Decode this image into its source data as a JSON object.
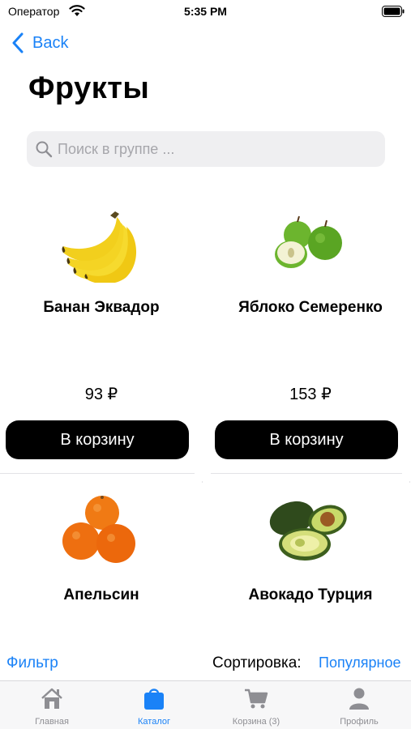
{
  "status_bar": {
    "carrier": "Оператор",
    "time": "5:35 PM"
  },
  "nav": {
    "back_label": "Back"
  },
  "page": {
    "title": "Фрукты"
  },
  "search": {
    "placeholder": "Поиск в группе ..."
  },
  "products": [
    {
      "name": "Банан Эквадор",
      "price": "93 ₽",
      "button_label": "В корзину",
      "image": "bananas"
    },
    {
      "name": "Яблоко Семеренко",
      "price": "153 ₽",
      "button_label": "В корзину",
      "image": "green-apples"
    },
    {
      "name": "Апельсин",
      "image": "oranges"
    },
    {
      "name": "Авокадо Турция",
      "image": "avocado"
    }
  ],
  "bottom_bar": {
    "filter_label": "Фильтр",
    "sort_label": "Сортировка:",
    "sort_value": "Популярное"
  },
  "tabs": [
    {
      "label": "Главная",
      "icon": "house-icon",
      "active": false
    },
    {
      "label": "Каталог",
      "icon": "bag-icon",
      "active": true
    },
    {
      "label": "Корзина (3)",
      "icon": "cart-icon",
      "active": false
    },
    {
      "label": "Профиль",
      "icon": "person-icon",
      "active": false
    }
  ],
  "colors": {
    "accent": "#1a82f7",
    "inactive_tab": "#8e8e93",
    "button_bg": "#000000"
  }
}
